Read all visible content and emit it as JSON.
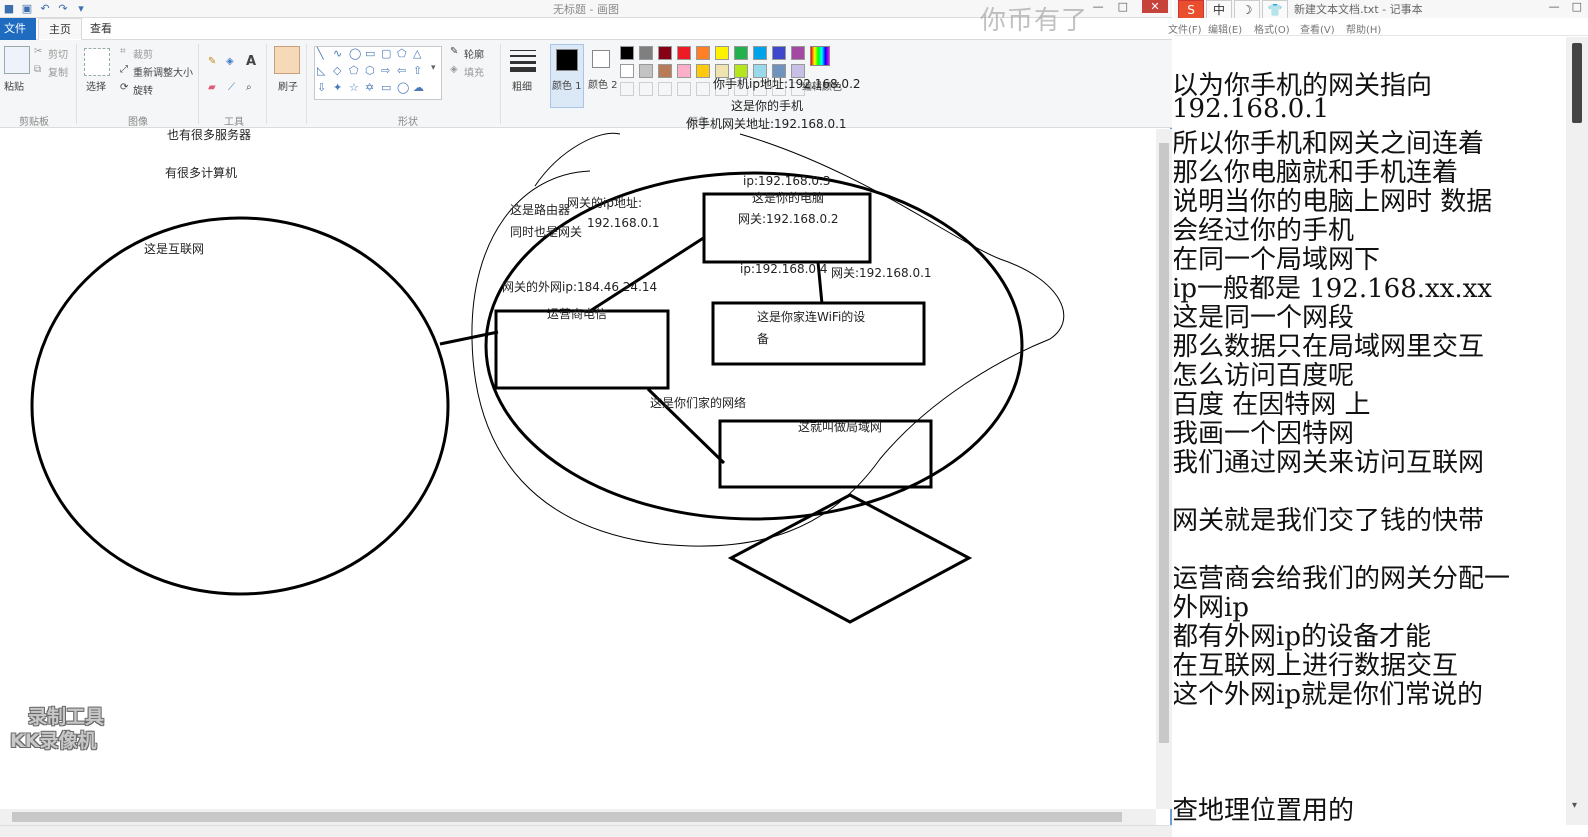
{
  "paint": {
    "window_title": "无标题 - 画图",
    "tabs": {
      "file": "文件",
      "home": "主页",
      "view": "查看"
    },
    "clipboard": {
      "paste": "粘贴",
      "cut": "剪切",
      "copy": "复制",
      "label": "剪贴板"
    },
    "image": {
      "select": "选择",
      "crop": "裁剪",
      "resize": "重新调整大小",
      "rotate": "旋转",
      "label": "图像"
    },
    "tools": {
      "label": "工具"
    },
    "brushes": {
      "label": "刷子"
    },
    "shapes": {
      "outline": "轮廓",
      "fill": "填充",
      "label": "形状"
    },
    "size": {
      "label": "粗细"
    },
    "colors": {
      "color1": "颜色 1",
      "color2": "颜色 2",
      "edit": "编辑颜色",
      "label": "颜色",
      "palette_row1": [
        "#000000",
        "#7f7f7f",
        "#880015",
        "#ed1c24",
        "#ff7f27",
        "#fff200",
        "#22b14c",
        "#00a2e8",
        "#3f48cc",
        "#a349a4"
      ],
      "palette_row2": [
        "#ffffff",
        "#c3c3c3",
        "#b97a57",
        "#ffaec9",
        "#ffc90e",
        "#efe4b0",
        "#b5e61d",
        "#99d9ea",
        "#7092be",
        "#c8bfe7"
      ]
    },
    "canvas_labels": {
      "many_servers": "也有很多服务器",
      "many_computers": "有很多计算机",
      "internet": "这是互联网",
      "router_line1": "这是路由器",
      "router_line2": "同时也是网关",
      "gateway_ip_title": "网关的ip地址:",
      "gateway_ip_value": "192.168.0.1",
      "external_ip": "网关的外网ip:184.46.24.14",
      "isp": "运营商电信",
      "phone_ip": "你手机ip地址:192.168.0.2",
      "phone_label": "这是你的手机",
      "phone_gateway": "你手机网关地址:192.168.0.1",
      "pc_ip": "ip:192.168.0.3",
      "pc_label": "这是你的电脑",
      "pc_gateway": "网关:192.168.0.2",
      "wifi_ip": "ip:192.168.0.4",
      "wifi_gateway": "网关:192.168.0.1",
      "wifi_device_line1": "这是你家连WiFi的设",
      "wifi_device_line2": "备",
      "home_network": "这是你们家的网络",
      "lan": "这就叫做局域网"
    },
    "watermark_top": "你币有了",
    "watermark_bottom_line1": "录制工具",
    "watermark_bottom_line2": "KK录像机"
  },
  "notepad": {
    "title": "新建文本文档.txt - 记事本",
    "menu": {
      "file": "文件(F)",
      "edit": "编辑(E)",
      "format": "格式(O)",
      "view": "查看(V)",
      "help": "帮助(H)"
    },
    "ime": {
      "logo": "S",
      "lang": "中",
      "moon": "☽",
      "shirt": "👕"
    },
    "lines": [
      "以为你手机的网关指向",
      "192.168.0.1",
      "所以你手机和网关之间连着",
      "那么你电脑就和手机连着",
      "说明当你的电脑上网时  数据",
      "会经过你的手机",
      "在同一个局域网下",
      "ip一般都是  192.168.xx.xx",
      "这是同一个网段",
      "那么数据只在局域网里交互",
      "怎么访问百度呢",
      "百度    在因特网  上",
      " 我画一个因特网",
      "我们通过网关来访问互联网",
      "",
      "网关就是我们交了钱的快带",
      "",
      "运营商会给我们的网关分配一",
      "外网ip",
      "都有外网ip的设备才能",
      "在互联网上进行数据交互",
      "这个外网ip就是你们常说的",
      "",
      "",
      "",
      " 查地理位置用的"
    ]
  }
}
